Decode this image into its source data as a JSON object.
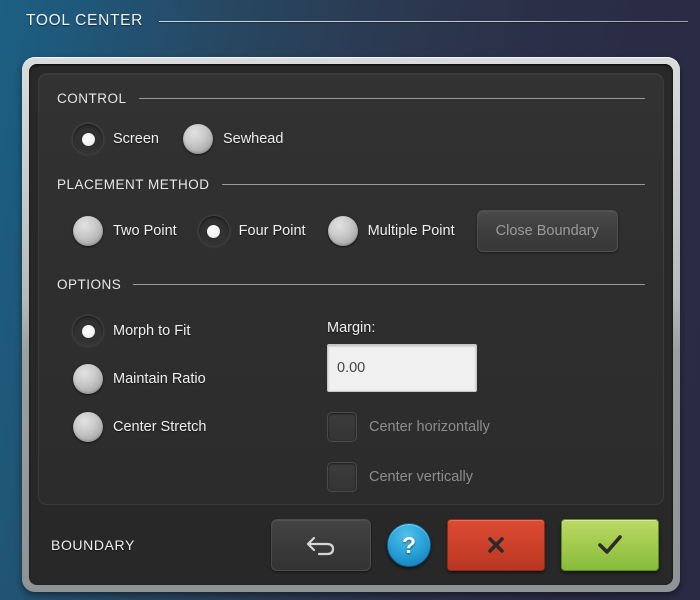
{
  "window": {
    "title": "TOOL CENTER"
  },
  "sections": {
    "control": {
      "heading": "CONTROL",
      "options": [
        {
          "label": "Screen",
          "selected": true
        },
        {
          "label": "Sewhead",
          "selected": false
        }
      ]
    },
    "placement": {
      "heading": "PLACEMENT METHOD",
      "options": [
        {
          "label": "Two Point",
          "selected": false
        },
        {
          "label": "Four Point",
          "selected": true
        },
        {
          "label": "Multiple Point",
          "selected": false
        }
      ],
      "close_boundary_label": "Close Boundary"
    },
    "options": {
      "heading": "OPTIONS",
      "radios": [
        {
          "label": "Morph to Fit",
          "selected": true
        },
        {
          "label": "Maintain Ratio",
          "selected": false
        },
        {
          "label": "Center Stretch",
          "selected": false
        }
      ],
      "margin_label": "Margin:",
      "margin_value": "0.00",
      "margin_placeholder": "0.00",
      "checkboxes": [
        {
          "label": "Center horizontally",
          "checked": false
        },
        {
          "label": "Center vertically",
          "checked": false
        }
      ]
    }
  },
  "footer": {
    "boundary_label": "BOUNDARY",
    "undo_icon": "undo-arrow-icon",
    "help_label": "?",
    "cancel_icon": "cross-icon",
    "confirm_icon": "checkmark-icon"
  },
  "colors": {
    "accent_blue": "#2ba4da",
    "cancel_red": "#cc412a",
    "confirm_green": "#a5cc4f",
    "panel_dark": "#2e2e2e",
    "frame_silver": "#b7babb",
    "bg_left": "#1b5f82",
    "bg_right": "#2a2a44"
  }
}
